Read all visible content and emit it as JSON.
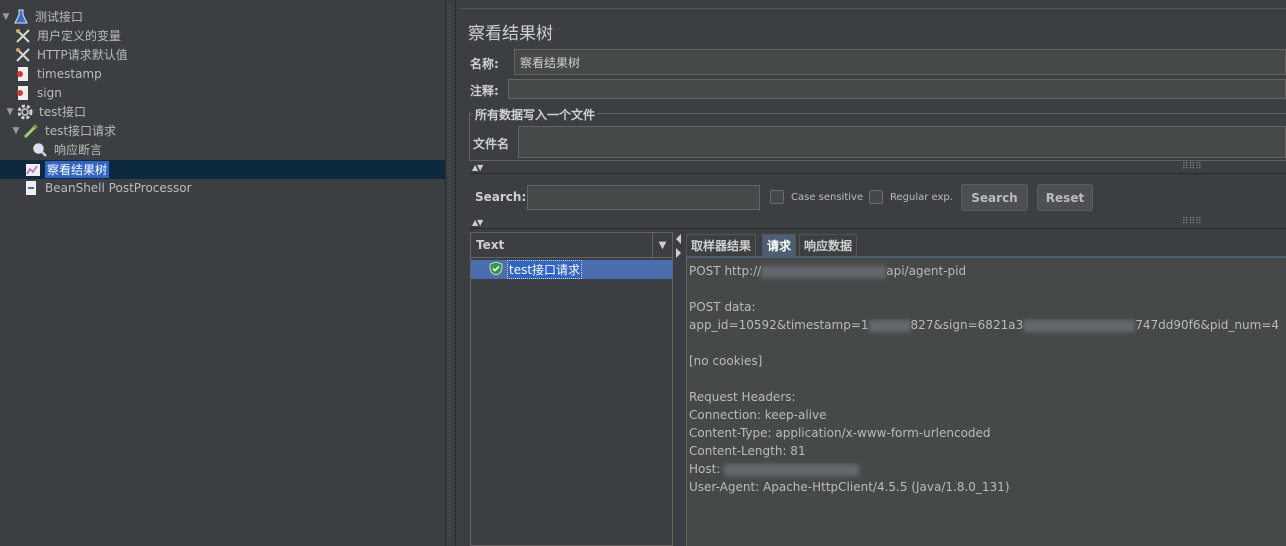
{
  "tree": {
    "items": [
      {
        "label": "测试接口",
        "icon": "flask-icon",
        "expanded": true
      },
      {
        "label": "用户定义的变量",
        "icon": "wrench-icon"
      },
      {
        "label": "HTTP请求默认值",
        "icon": "wrench-icon"
      },
      {
        "label": "timestamp",
        "icon": "preprocessor-icon"
      },
      {
        "label": "sign",
        "icon": "preprocessor-icon"
      },
      {
        "label": "test接口",
        "icon": "gear-icon",
        "expanded": true
      },
      {
        "label": "test接口请求",
        "icon": "pipette-icon",
        "expanded": true
      },
      {
        "label": "响应断言",
        "icon": "magnifier-icon"
      },
      {
        "label": "察看结果树",
        "icon": "chart-icon",
        "selected": true
      },
      {
        "label": "BeanShell PostProcessor",
        "icon": "postprocessor-icon"
      }
    ]
  },
  "panel": {
    "title": "察看结果树",
    "name_label": "名称:",
    "name_value": "察看结果树",
    "comment_label": "注释:",
    "comment_value": "",
    "file_group_title": "所有数据写入一个文件",
    "filename_label": "文件名",
    "filename_value": ""
  },
  "search": {
    "label": "Search:",
    "value": "",
    "case_sensitive_label": "Case sensitive",
    "case_sensitive_checked": false,
    "regex_label": "Regular exp.",
    "regex_checked": false,
    "search_button": "Search",
    "reset_button": "Reset"
  },
  "results": {
    "renderer": "Text",
    "items": [
      {
        "label": "test接口请求",
        "status": "success"
      }
    ]
  },
  "detail": {
    "tabs": [
      "取样器结果",
      "请求",
      "响应数据"
    ],
    "active_tab": "请求",
    "lines": [
      "POST http://[redacted]api/agent-pid",
      "",
      "POST data:",
      "app_id=10592&timestamp=1[redacted]827&sign=6821a3[redacted]747dd90f6&pid_num=4",
      "",
      "[no cookies]",
      "",
      "Request Headers:",
      "Connection: keep-alive",
      "Content-Type: application/x-www-form-urlencoded",
      "Content-Length: 81",
      "Host: [redacted]",
      "User-Agent: Apache-HttpClient/4.5.5 (Java/1.8.0_131)"
    ],
    "segments": {
      "post_url_prefix": "POST http://",
      "post_url_suffix": "api/agent-pid",
      "post_data_label": "POST data:",
      "post_data_p1": "app_id=10592&timestamp=1",
      "post_data_p2": "827&sign=6821a3",
      "post_data_p3": "747dd90f6&pid_num=4",
      "no_cookies": "[no cookies]",
      "headers_label": "Request Headers:",
      "h_connection": "Connection: keep-alive",
      "h_content_type": "Content-Type: application/x-www-form-urlencoded",
      "h_content_length": "Content-Length: 81",
      "h_host": "Host: ",
      "h_user_agent": "User-Agent: Apache-HttpClient/4.5.5 (Java/1.8.0_131)"
    }
  },
  "colors": {
    "background": "#3c3f41",
    "selection": "#2f65ca",
    "selected_row_bg": "#0d293e",
    "input_bg": "#45494a"
  }
}
